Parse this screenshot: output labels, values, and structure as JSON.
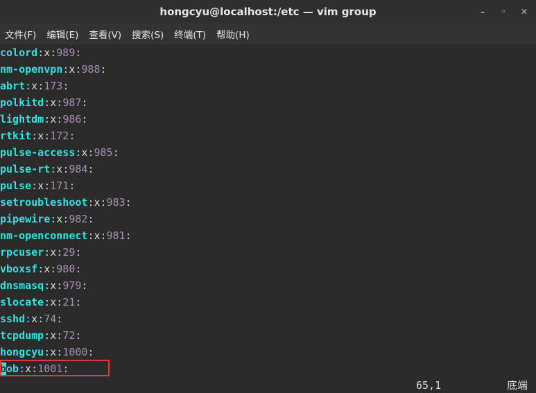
{
  "window": {
    "title": "hongcyu@localhost:/etc — vim group",
    "controls": [
      "minimize",
      "maximize",
      "close"
    ]
  },
  "menu": [
    "文件(F)",
    "编辑(E)",
    "查看(V)",
    "搜索(S)",
    "终端(T)",
    "帮助(H)"
  ],
  "lines": [
    {
      "name": "colord",
      "x": "x",
      "gid": "989"
    },
    {
      "name": "nm-openvpn",
      "x": "x",
      "gid": "988"
    },
    {
      "name": "abrt",
      "x": "x",
      "gid": "173"
    },
    {
      "name": "polkitd",
      "x": "x",
      "gid": "987"
    },
    {
      "name": "lightdm",
      "x": "x",
      "gid": "986"
    },
    {
      "name": "rtkit",
      "x": "x",
      "gid": "172"
    },
    {
      "name": "pulse-access",
      "x": "x",
      "gid": "985"
    },
    {
      "name": "pulse-rt",
      "x": "x",
      "gid": "984"
    },
    {
      "name": "pulse",
      "x": "x",
      "gid": "171"
    },
    {
      "name": "setroubleshoot",
      "x": "x",
      "gid": "983"
    },
    {
      "name": "pipewire",
      "x": "x",
      "gid": "982"
    },
    {
      "name": "nm-openconnect",
      "x": "x",
      "gid": "981"
    },
    {
      "name": "rpcuser",
      "x": "x",
      "gid": "29"
    },
    {
      "name": "vboxsf",
      "x": "x",
      "gid": "980"
    },
    {
      "name": "dnsmasq",
      "x": "x",
      "gid": "979"
    },
    {
      "name": "slocate",
      "x": "x",
      "gid": "21"
    },
    {
      "name": "sshd",
      "x": "x",
      "gid": "74"
    },
    {
      "name": "tcpdump",
      "x": "x",
      "gid": "72"
    },
    {
      "name": "hongcyu",
      "x": "x",
      "gid": "1000"
    },
    {
      "name": "bob",
      "x": "x",
      "gid": "1001"
    }
  ],
  "status": {
    "position": "65,1",
    "scroll": "底端"
  },
  "colors": {
    "name": "#34e2e2",
    "gid": "#a98fb5",
    "highlight": "#e2393a",
    "background": "#2b2b2b"
  }
}
